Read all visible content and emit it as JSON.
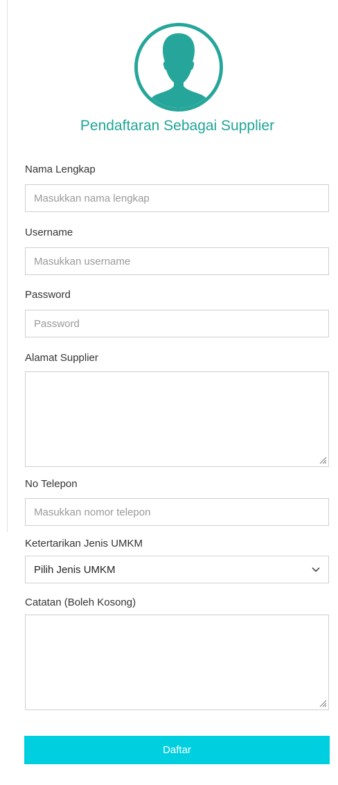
{
  "form": {
    "title": "Pendaftaran Sebagai Supplier",
    "avatar_icon": "user-avatar-icon",
    "accent_color": "#26a69a",
    "fields": {
      "nama": {
        "label": "Nama Lengkap",
        "placeholder": "Masukkan nama lengkap",
        "value": ""
      },
      "username": {
        "label": "Username",
        "placeholder": "Masukkan username",
        "value": ""
      },
      "password": {
        "label": "Password",
        "placeholder": "Password",
        "value": ""
      },
      "alamat": {
        "label": "Alamat Supplier",
        "value": ""
      },
      "telepon": {
        "label": "No Telepon",
        "placeholder": "Masukkan nomor telepon",
        "value": ""
      },
      "umkm": {
        "label": "Ketertarikan Jenis UMKM",
        "selected": "Pilih Jenis UMKM"
      },
      "catatan": {
        "label": "Catatan (Boleh Kosong)",
        "value": ""
      }
    },
    "submit": {
      "label": "Daftar",
      "color": "#00cfe0"
    }
  }
}
